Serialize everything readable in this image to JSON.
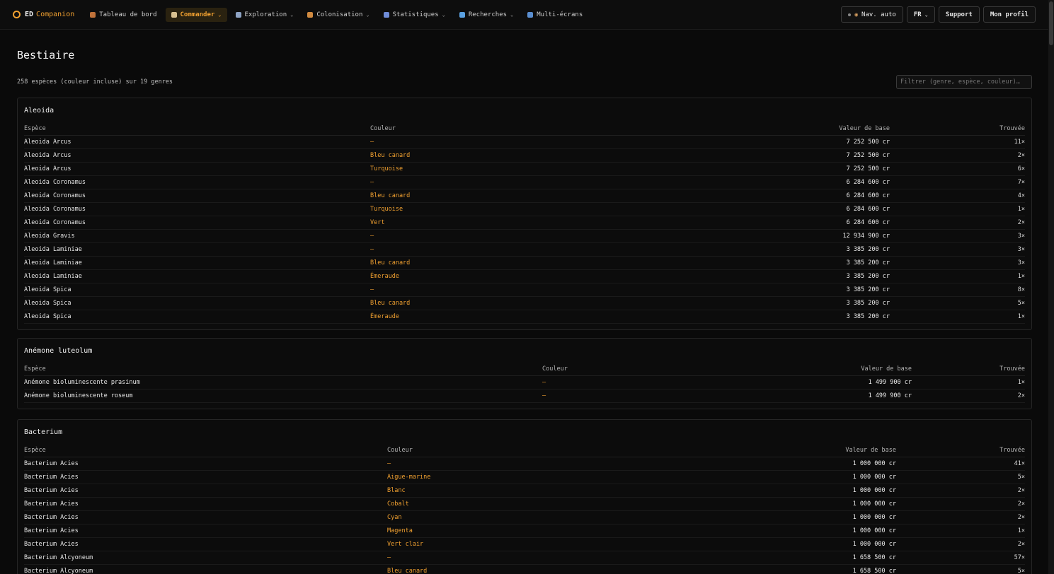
{
  "app": {
    "name_part1": "ED",
    "name_part2": "Companion"
  },
  "nav": [
    {
      "label": "Tableau de bord",
      "icon": "dashboard-icon",
      "color": "#c0723a",
      "chevron": false,
      "active": false
    },
    {
      "label": "Commander",
      "icon": "commander-icon",
      "color": "#d8c090",
      "chevron": true,
      "active": true
    },
    {
      "label": "Exploration",
      "icon": "telescope-icon",
      "color": "#8ea3c4",
      "chevron": true,
      "active": false
    },
    {
      "label": "Colonisation",
      "icon": "planet-icon",
      "color": "#d08a40",
      "chevron": true,
      "active": false
    },
    {
      "label": "Statistiques",
      "icon": "chart-icon",
      "color": "#6f8cd8",
      "chevron": true,
      "active": false
    },
    {
      "label": "Recherches",
      "icon": "magnifier-icon",
      "color": "#5aa0e0",
      "chevron": true,
      "active": false
    },
    {
      "label": "Multi-écrans",
      "icon": "monitor-icon",
      "color": "#5a8ed0",
      "chevron": false,
      "active": false
    }
  ],
  "controls": {
    "nav_auto": "Nav. auto",
    "lang": "FR",
    "support": "Support",
    "profile": "Mon profil"
  },
  "page": {
    "title": "Bestiaire",
    "summary": "258 espèces (couleur incluse) sur 19 genres",
    "filter_placeholder": "Filtrer (genre, espèce, couleur)…"
  },
  "headers": {
    "species": "Espèce",
    "color": "Couleur",
    "value": "Valeur de base",
    "found": "Trouvée"
  },
  "accent_color": "#f0a030",
  "groups": [
    {
      "name": "Aleoida",
      "rows": [
        {
          "species": "Aleoida Arcus",
          "color": "—",
          "value": "7 252 500 cr",
          "found": "11×"
        },
        {
          "species": "Aleoida Arcus",
          "color": "Bleu canard",
          "value": "7 252 500 cr",
          "found": "2×"
        },
        {
          "species": "Aleoida Arcus",
          "color": "Turquoise",
          "value": "7 252 500 cr",
          "found": "6×"
        },
        {
          "species": "Aleoida Coronamus",
          "color": "—",
          "value": "6 284 600 cr",
          "found": "7×"
        },
        {
          "species": "Aleoida Coronamus",
          "color": "Bleu canard",
          "value": "6 284 600 cr",
          "found": "4×"
        },
        {
          "species": "Aleoida Coronamus",
          "color": "Turquoise",
          "value": "6 284 600 cr",
          "found": "1×"
        },
        {
          "species": "Aleoida Coronamus",
          "color": "Vert",
          "value": "6 284 600 cr",
          "found": "2×"
        },
        {
          "species": "Aleoida Gravis",
          "color": "—",
          "value": "12 934 900 cr",
          "found": "3×"
        },
        {
          "species": "Aleoida Laminiae",
          "color": "—",
          "value": "3 385 200 cr",
          "found": "3×"
        },
        {
          "species": "Aleoida Laminiae",
          "color": "Bleu canard",
          "value": "3 385 200 cr",
          "found": "3×"
        },
        {
          "species": "Aleoida Laminiae",
          "color": "Émeraude",
          "value": "3 385 200 cr",
          "found": "1×"
        },
        {
          "species": "Aleoida Spica",
          "color": "—",
          "value": "3 385 200 cr",
          "found": "8×"
        },
        {
          "species": "Aleoida Spica",
          "color": "Bleu canard",
          "value": "3 385 200 cr",
          "found": "5×"
        },
        {
          "species": "Aleoida Spica",
          "color": "Émeraude",
          "value": "3 385 200 cr",
          "found": "1×"
        }
      ]
    },
    {
      "name": "Anémone luteolum",
      "rows": [
        {
          "species": "Anémone bioluminescente prasinum",
          "color": "—",
          "value": "1 499 900 cr",
          "found": "1×"
        },
        {
          "species": "Anémone bioluminescente roseum",
          "color": "—",
          "value": "1 499 900 cr",
          "found": "2×"
        }
      ]
    },
    {
      "name": "Bacterium",
      "rows": [
        {
          "species": "Bacterium Acies",
          "color": "—",
          "value": "1 000 000 cr",
          "found": "41×"
        },
        {
          "species": "Bacterium Acies",
          "color": "Aigue-marine",
          "value": "1 000 000 cr",
          "found": "5×"
        },
        {
          "species": "Bacterium Acies",
          "color": "Blanc",
          "value": "1 000 000 cr",
          "found": "2×"
        },
        {
          "species": "Bacterium Acies",
          "color": "Cobalt",
          "value": "1 000 000 cr",
          "found": "2×"
        },
        {
          "species": "Bacterium Acies",
          "color": "Cyan",
          "value": "1 000 000 cr",
          "found": "2×"
        },
        {
          "species": "Bacterium Acies",
          "color": "Magenta",
          "value": "1 000 000 cr",
          "found": "1×"
        },
        {
          "species": "Bacterium Acies",
          "color": "Vert clair",
          "value": "1 000 000 cr",
          "found": "2×"
        },
        {
          "species": "Bacterium Alcyoneum",
          "color": "—",
          "value": "1 658 500 cr",
          "found": "57×"
        },
        {
          "species": "Bacterium Alcyoneum",
          "color": "Bleu canard",
          "value": "1 658 500 cr",
          "found": "5×"
        }
      ]
    }
  ]
}
